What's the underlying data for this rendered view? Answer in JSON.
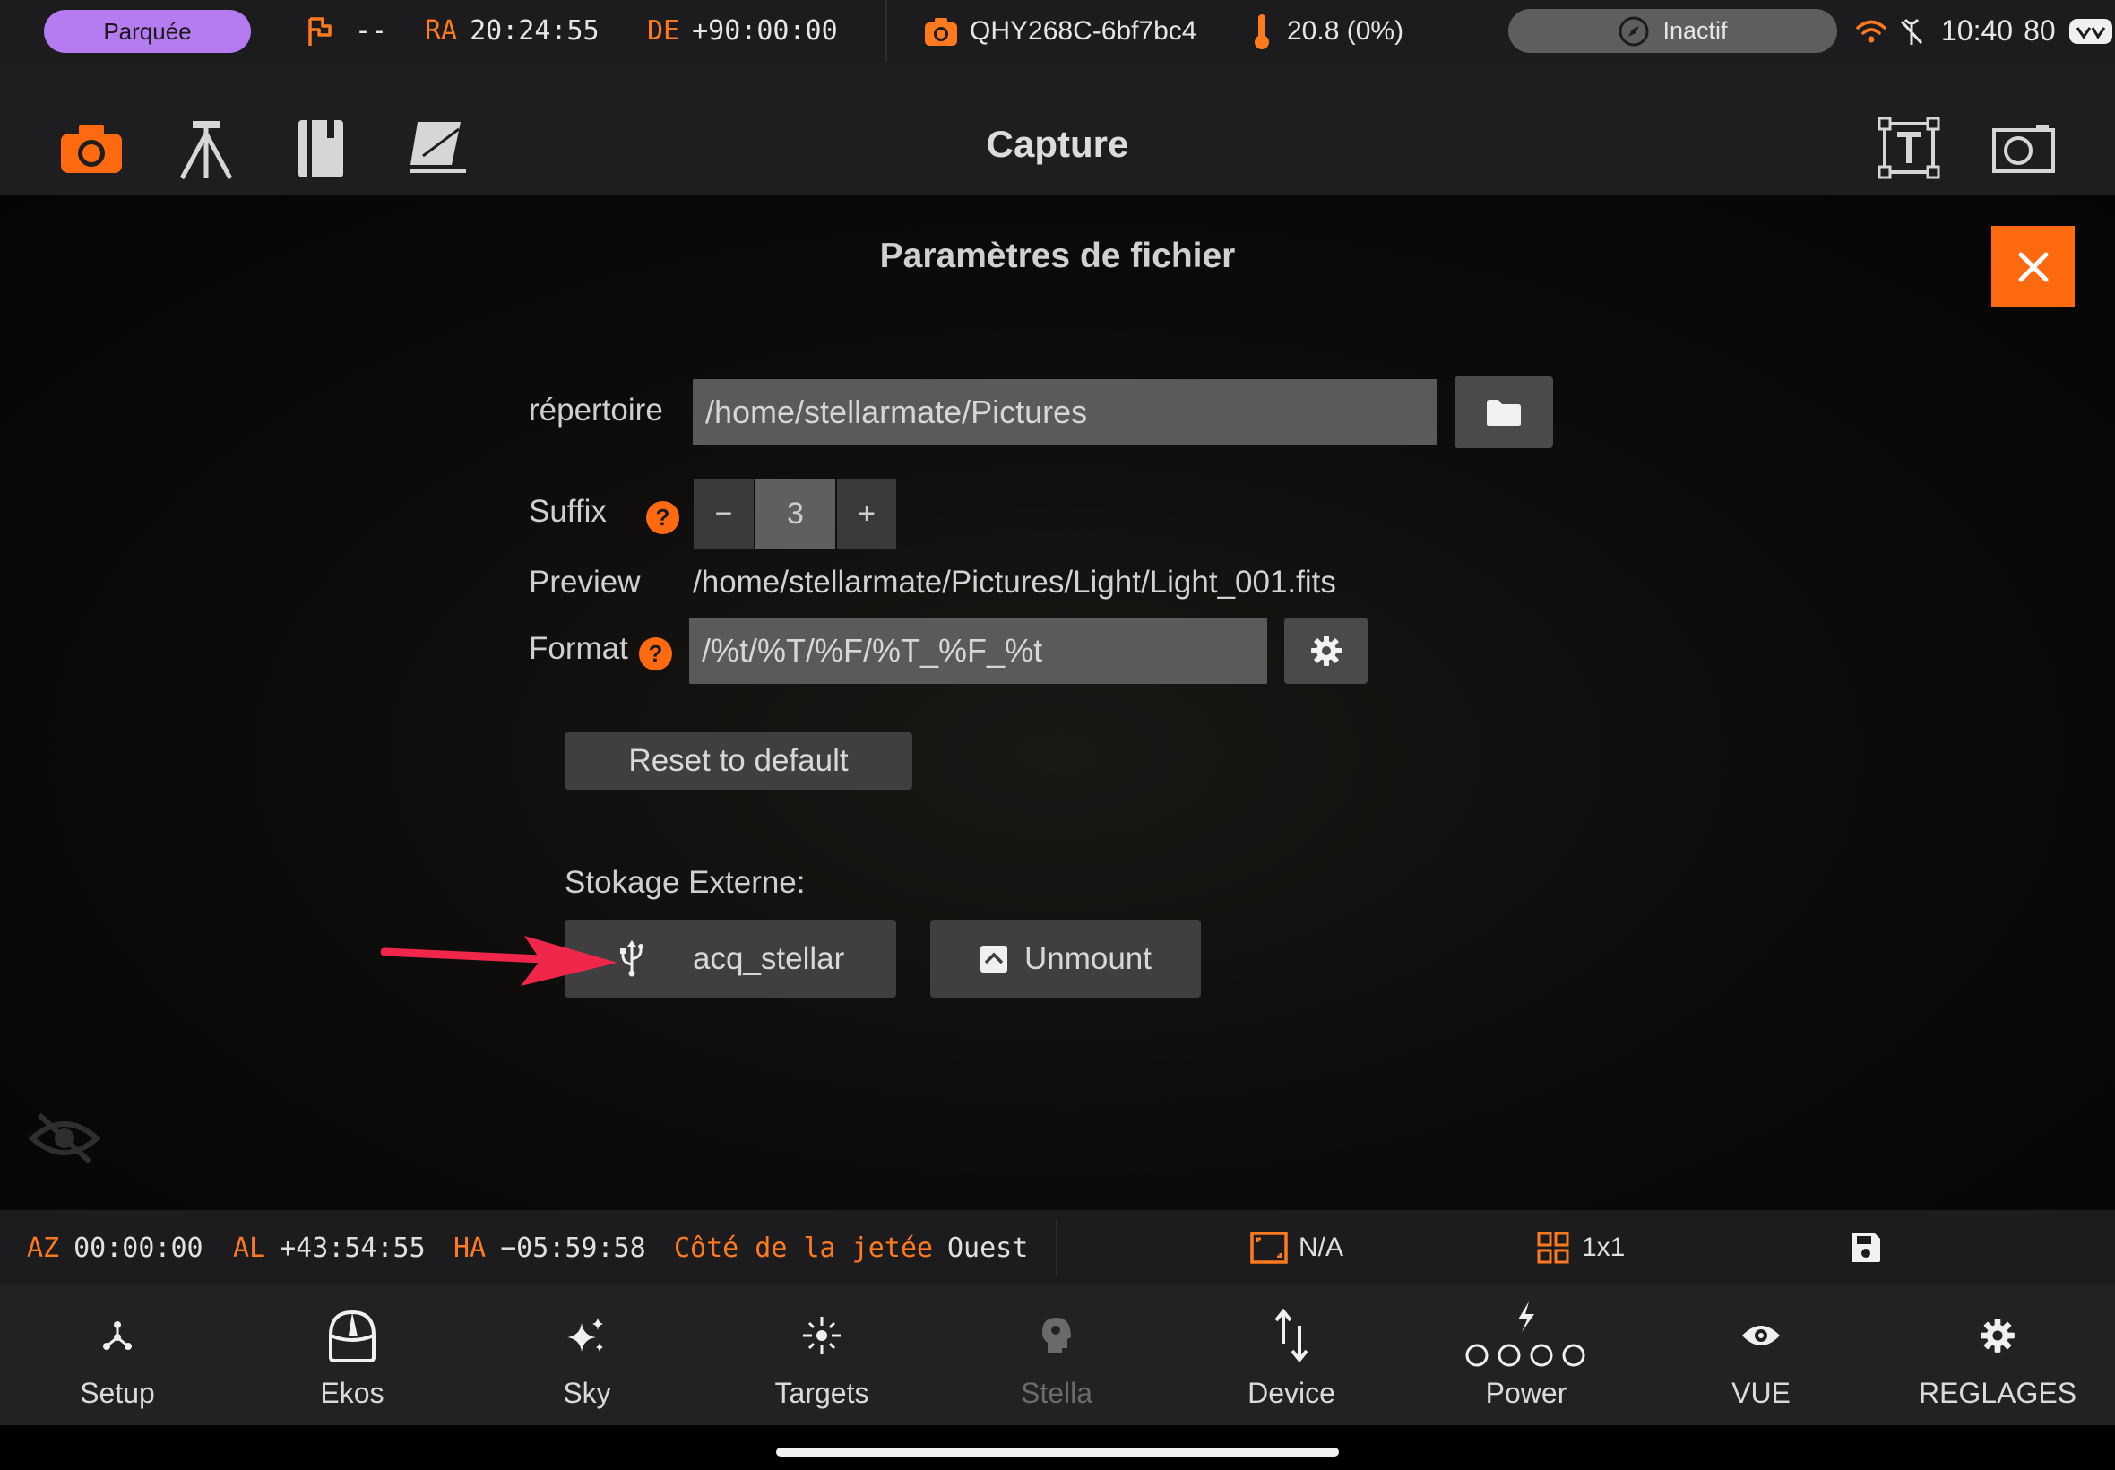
{
  "status_bar": {
    "mount_status": "Parquée",
    "mount_value": "--",
    "ra_label": "RA",
    "ra_value": "20:24:55",
    "de_label": "DE",
    "de_value": "+90:00:00",
    "camera_name": "QHY268C-6bf7bc4",
    "temperature": "20.8 (0%)",
    "guide_status": "Inactif",
    "time": "10:40",
    "battery": "80"
  },
  "toolbar": {
    "title": "Capture",
    "icons": [
      "camera-icon",
      "tripod-icon",
      "notebook-icon",
      "filter-icon",
      "text-frame-icon",
      "screenshot-icon"
    ]
  },
  "dialog": {
    "title": "Paramètres de fichier",
    "directory": {
      "label": "répertoire",
      "value": "/home/stellarmate/Pictures"
    },
    "suffix": {
      "label": "Suffix",
      "help": "?",
      "minus": "−",
      "value": "3",
      "plus": "+"
    },
    "preview": {
      "label": "Preview",
      "value": "/home/stellarmate/Pictures/Light/Light_001.fits"
    },
    "format": {
      "label": "Format",
      "help": "?",
      "value": "/%t/%T/%F/%T_%F_%t"
    },
    "reset_label": "Reset to default",
    "storage": {
      "label": "Stokage Externe:",
      "device_label": "acq_stellar",
      "unmount_label": "Unmount"
    }
  },
  "info_bar": {
    "az_label": "AZ",
    "az_value": "00:00:00",
    "al_label": "AL",
    "al_value": "+43:54:55",
    "ha_label": "HA",
    "ha_value": "−05:59:58",
    "pier_label": "Côté de la jetée",
    "pier_value": "Ouest",
    "frame_value": "N/A",
    "binning_value": "1x1"
  },
  "bottom_nav": {
    "items": [
      {
        "label": "Setup",
        "icon": "setup-icon"
      },
      {
        "label": "Ekos",
        "icon": "observatory-icon"
      },
      {
        "label": "Sky",
        "icon": "sparkles-icon"
      },
      {
        "label": "Targets",
        "icon": "target-icon"
      },
      {
        "label": "Stella",
        "icon": "brain-icon"
      },
      {
        "label": "Device",
        "icon": "device-arrows-icon"
      },
      {
        "label": "Power",
        "icon": "power-icon"
      },
      {
        "label": "VUE",
        "icon": "eye-icon"
      },
      {
        "label": "REGLAGES",
        "icon": "gear-icon"
      }
    ]
  },
  "colors": {
    "accent_orange": "#ff6a10",
    "park_purple": "#b57cf1",
    "annotation_red": "#f0264a"
  }
}
